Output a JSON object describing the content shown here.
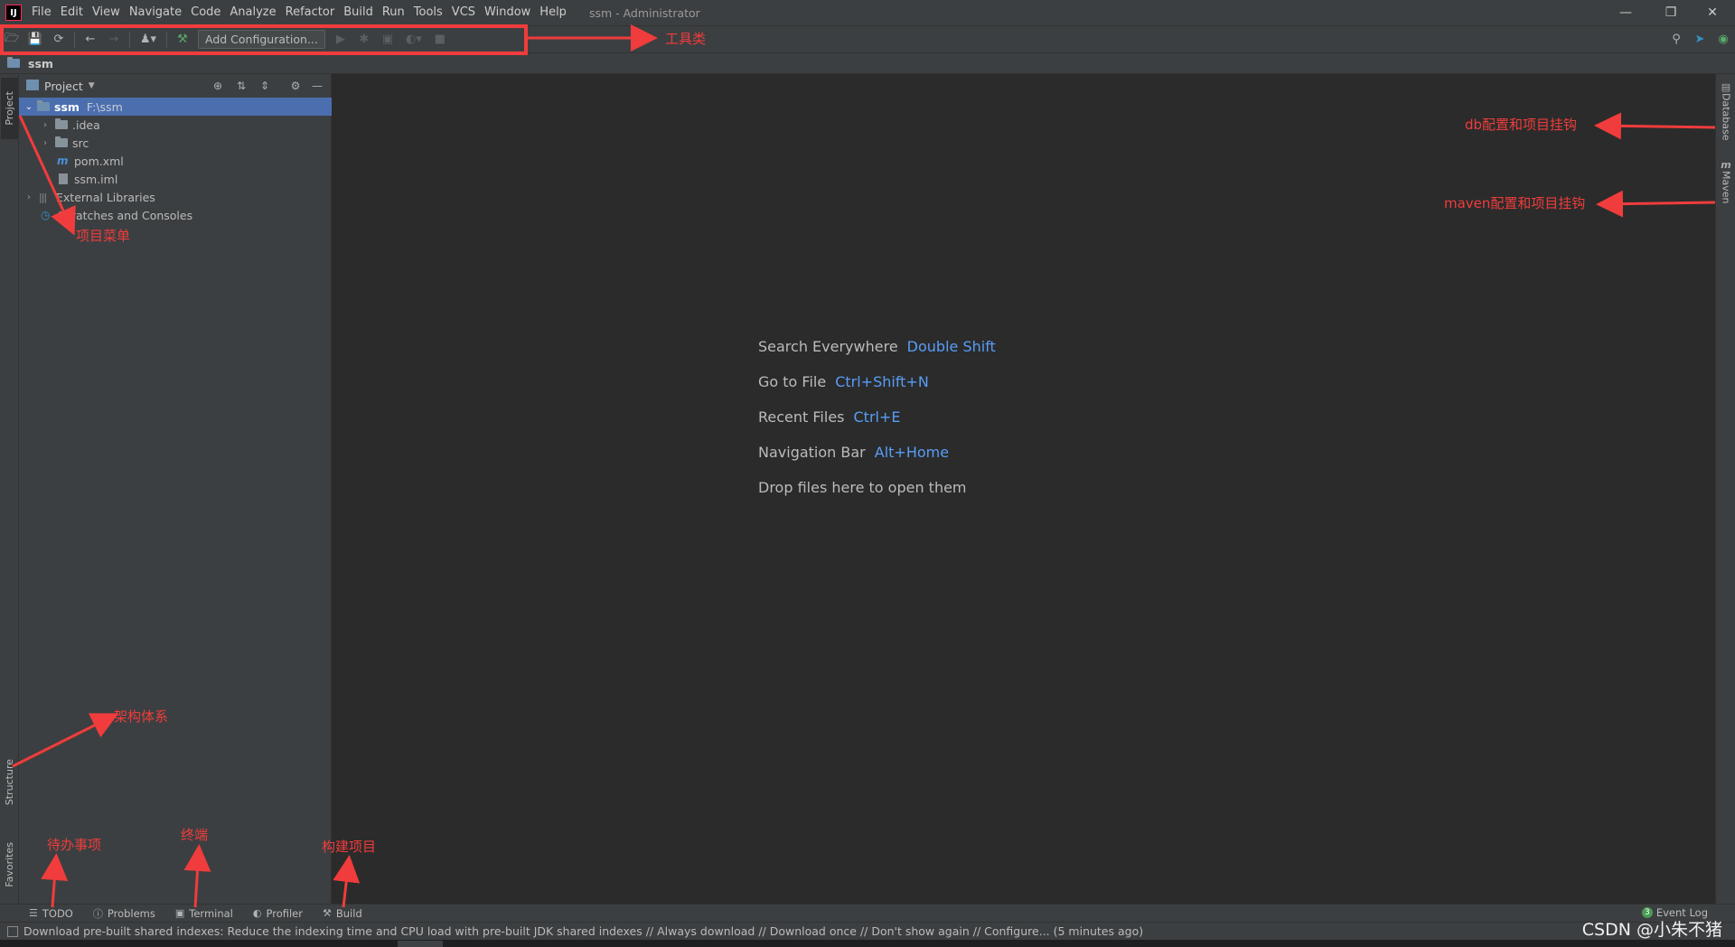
{
  "app": {
    "logo_text": "IJ",
    "window_title": "ssm - Administrator",
    "menu": [
      "File",
      "Edit",
      "View",
      "Navigate",
      "Code",
      "Analyze",
      "Refactor",
      "Build",
      "Run",
      "Tools",
      "VCS",
      "Window",
      "Help"
    ]
  },
  "toolbar": {
    "add_configuration": "Add Configuration..."
  },
  "breadcrumb": {
    "label": "ssm"
  },
  "left_strip": {
    "project_tab": "Project",
    "structure_tab": "Structure",
    "favorites_tab": "Favorites"
  },
  "project_panel": {
    "title": "Project",
    "tree": [
      {
        "label": "ssm",
        "hint": "F:\\ssm"
      },
      {
        "label": ".idea"
      },
      {
        "label": "src"
      },
      {
        "label": "pom.xml"
      },
      {
        "label": "ssm.iml"
      },
      {
        "label": "External Libraries"
      },
      {
        "label": "Scratches and Consoles"
      }
    ]
  },
  "editor_hints": [
    {
      "action": "Search Everywhere",
      "shortcut": "Double Shift"
    },
    {
      "action": "Go to File",
      "shortcut": "Ctrl+Shift+N"
    },
    {
      "action": "Recent Files",
      "shortcut": "Ctrl+E"
    },
    {
      "action": "Navigation Bar",
      "shortcut": "Alt+Home"
    },
    {
      "action": "Drop files here to open them",
      "shortcut": ""
    }
  ],
  "right_strip": {
    "database_tab": "Database",
    "maven_tab": "Maven"
  },
  "bottom_bar": {
    "items": [
      "TODO",
      "Problems",
      "Terminal",
      "Profiler",
      "Build"
    ],
    "event_log": "Event Log",
    "event_count": "3"
  },
  "status_bar": {
    "message": "Download pre-built shared indexes: Reduce the indexing time and CPU load with pre-built JDK shared indexes // Always download // Download once // Don't show again // Configure... (5 minutes ago)"
  },
  "watermark": "CSDN @小朱不猪",
  "annotations": {
    "toolbar": "工具类",
    "project_menu": "项目菜单",
    "database": "db配置和项目挂钩",
    "maven": "maven配置和项目挂钩",
    "structure": "架构体系",
    "todo": "待办事项",
    "terminal": "终端",
    "build": "构建项目"
  },
  "colors": {
    "annotation": "#f03c3c",
    "selection": "#4b6eaf",
    "shortcut": "#589df6"
  }
}
